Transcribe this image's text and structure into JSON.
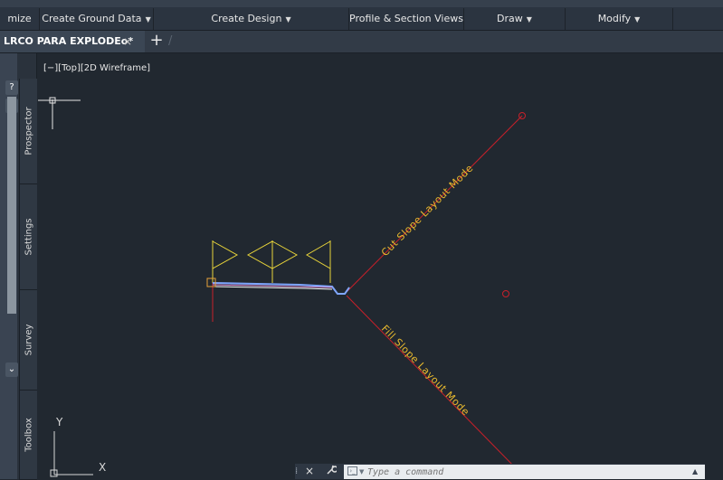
{
  "ribbon": {
    "panels": [
      {
        "label": "mize",
        "dropdown": false
      },
      {
        "label": "Create Ground Data",
        "dropdown": true
      },
      {
        "label": "Create Design",
        "dropdown": true
      },
      {
        "label": "Profile & Section Views",
        "dropdown": false
      },
      {
        "label": "Draw",
        "dropdown": true
      },
      {
        "label": "Modify",
        "dropdown": true
      }
    ],
    "dropdown_glyph": "▼"
  },
  "file_tabs": {
    "active_tab_label": "LRCO PARA EXPLODEo*",
    "close_glyph": "×",
    "new_tab_glyph": "+",
    "separator_glyph": "/"
  },
  "palette": {
    "tabs": [
      "Prospector",
      "Settings",
      "Survey",
      "Toolbox"
    ]
  },
  "viewport": {
    "label": "[−][Top][2D Wireframe]",
    "annotations": {
      "cut_slope": "Cut Slope Layout Mode",
      "fill_slope": "Fill Slope Layout Mode"
    },
    "ucs": {
      "x_label": "X",
      "y_label": "Y"
    }
  },
  "command_line": {
    "placeholder": "Type a command",
    "value": "",
    "close_glyph": "×",
    "wrench_glyph": "🔧",
    "history_glyph": "▲"
  },
  "colors": {
    "background": "#212830",
    "ribbon": "#2b3440",
    "annotation_yellow": "#e8b92e",
    "marker_red": "#c8202a",
    "assembly_blue": "#7fa6ff",
    "ucs_gray": "#d8d8d8"
  }
}
